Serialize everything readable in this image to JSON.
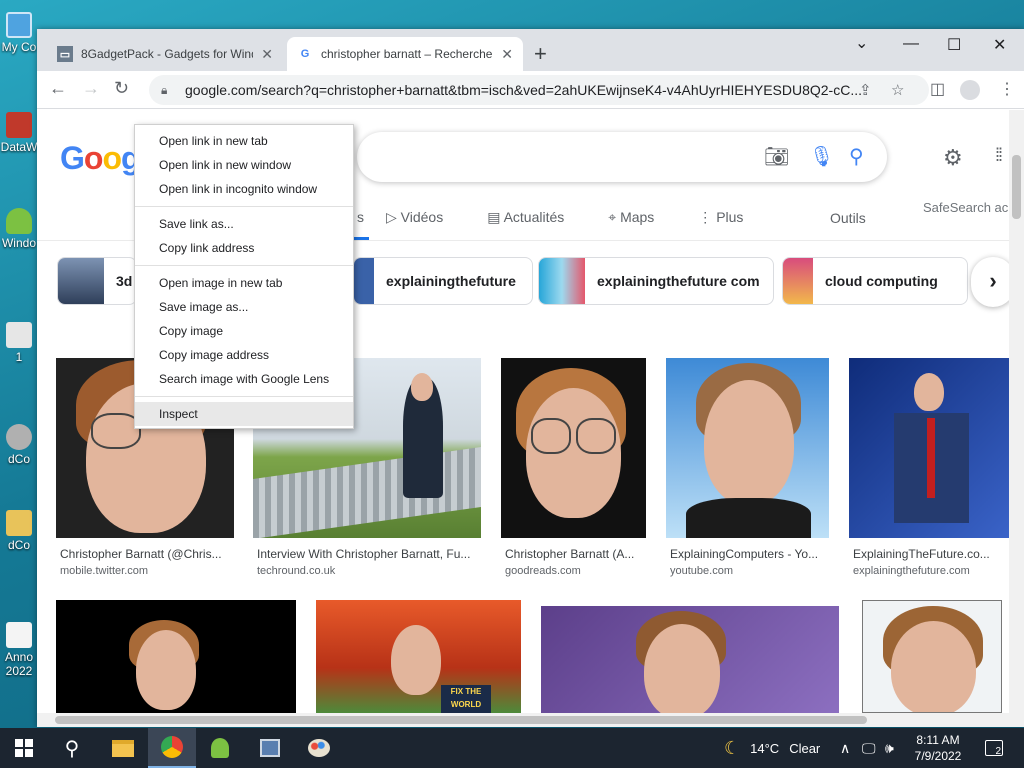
{
  "desktop": {
    "icons": [
      {
        "label": "My Co",
        "icon": "computer-icon"
      },
      {
        "label": "DataW",
        "icon": "shortcut-icon"
      },
      {
        "label": "Windo",
        "icon": "android-icon"
      },
      {
        "label": "1",
        "icon": "file-icon"
      },
      {
        "label": "dCo",
        "icon": "gear-icon"
      },
      {
        "label": "dCo",
        "icon": "folder-icon"
      },
      {
        "label": "Anno 2022",
        "icon": "document-icon"
      }
    ]
  },
  "browser": {
    "tabs": [
      {
        "title": "8GadgetPack - Gadgets for Wind",
        "icon": "laptop-favicon"
      },
      {
        "title": "christopher barnatt – Recherche",
        "icon": "google-favicon",
        "active": true
      }
    ],
    "new_tab": "+",
    "window_controls": {
      "minimize": "⌄",
      "min": "—",
      "max": "☐",
      "close": "✕"
    },
    "url": "google.com/search?q=christopher+barnatt&tbm=isch&ved=2ahUKEwijnseK4-v4AhUyrHIEHYESDU8Q2-cC..."
  },
  "search": {
    "logo": "Google",
    "nav_tabs": [
      "Vidéos",
      "Actualités",
      "Maps",
      "Plus"
    ],
    "tools": "Outils",
    "safesearch": "SafeSearch ac"
  },
  "chips": [
    {
      "label": "3d"
    },
    {
      "label": "explainingthefuture"
    },
    {
      "label": "explainingthefuture com"
    },
    {
      "label": "cloud computing"
    }
  ],
  "results": [
    {
      "title": "Christopher Barnatt (@Chris...",
      "source": "mobile.twitter.com"
    },
    {
      "title": "Interview With Christopher Barnatt, Fu...",
      "source": "techround.co.uk"
    },
    {
      "title": "Christopher Barnatt (A...",
      "source": "goodreads.com"
    },
    {
      "title": "ExplainingComputers - Yo...",
      "source": "youtube.com"
    },
    {
      "title": "ExplainingTheFuture.co...",
      "source": "explainingthefuture.com"
    }
  ],
  "book_text": "FIX THE WORLD",
  "context_menu": {
    "group1": [
      "Open link in new tab",
      "Open link in new window",
      "Open link in incognito window"
    ],
    "group2": [
      "Save link as...",
      "Copy link address"
    ],
    "group3": [
      "Open image in new tab",
      "Save image as...",
      "Copy image",
      "Copy image address",
      "Search image with Google Lens"
    ],
    "group4": [
      "Inspect"
    ]
  },
  "taskbar": {
    "weather_temp": "14°C",
    "weather_desc": "Clear",
    "time": "8:11 AM",
    "date": "7/9/2022",
    "notifications": "2"
  }
}
